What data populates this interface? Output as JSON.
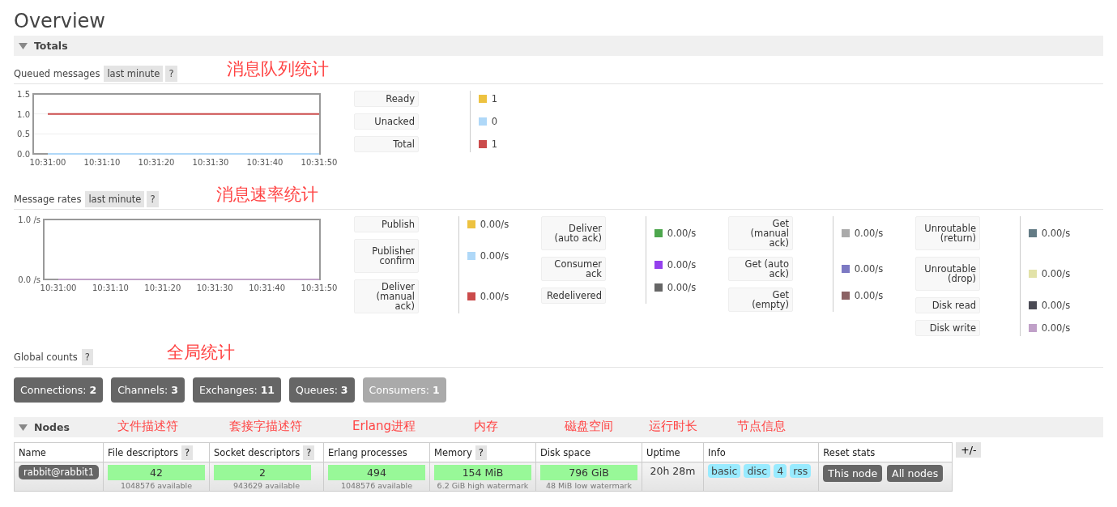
{
  "page_title": "Overview",
  "totals": {
    "title": "Totals",
    "expanded": true,
    "queued": {
      "label": "Queued messages",
      "range": "last minute",
      "help": "?",
      "annotation": "消息队列统计",
      "chart_data": {
        "type": "line",
        "categories": [
          "10:31:00",
          "10:31:10",
          "10:31:20",
          "10:31:30",
          "10:31:40",
          "10:31:50"
        ],
        "ylim": [
          0,
          1.5
        ],
        "yticks": [
          {
            "value": 0,
            "label": "0.0"
          },
          {
            "value": 0.5,
            "label": "0.5"
          },
          {
            "value": 1,
            "label": "1.0"
          },
          {
            "value": 1.5,
            "label": "1.5"
          }
        ],
        "series": [
          {
            "name": "Ready",
            "color": "#edc240",
            "values": [
              null,
              null,
              null,
              null,
              null,
              null
            ]
          },
          {
            "name": "Unacked",
            "color": "#afd8f8",
            "values": [
              0,
              0,
              0,
              0,
              0,
              0
            ]
          },
          {
            "name": "Total",
            "color": "#cb4b4b",
            "values": [
              1,
              1,
              1,
              1,
              1,
              1
            ]
          }
        ]
      },
      "readings": [
        "1",
        "0",
        "1"
      ]
    },
    "rates": {
      "label": "Message rates",
      "range": "last minute",
      "help": "?",
      "annotation": "消息速率统计",
      "chart_data": {
        "type": "line",
        "categories": [
          "10:31:00",
          "10:31:10",
          "10:31:20",
          "10:31:30",
          "10:31:40",
          "10:31:50"
        ],
        "ylim": [
          0,
          1
        ],
        "yticks": [
          {
            "value": 0,
            "label": "0.0 /s"
          },
          {
            "value": 1,
            "label": "1.0 /s"
          }
        ],
        "series": [
          {
            "name": "Publish",
            "color": "#edc240",
            "values": [
              null,
              null,
              null,
              null,
              null,
              null
            ]
          },
          {
            "name": "Publisher confirm",
            "color": "#afd8f8",
            "values": [
              null,
              null,
              null,
              null,
              null,
              null
            ]
          },
          {
            "name": "Deliver (manual ack)",
            "color": "#cb4b4b",
            "values": [
              null,
              null,
              null,
              null,
              null,
              null
            ]
          },
          {
            "name": "Deliver (auto ack)",
            "color": "#4da74d",
            "values": [
              null,
              null,
              null,
              null,
              null,
              null
            ]
          },
          {
            "name": "Consumer ack",
            "color": "#9440ed",
            "values": [
              null,
              null,
              null,
              null,
              null,
              null
            ]
          },
          {
            "name": "Redelivered",
            "color": "#666666",
            "values": [
              null,
              null,
              null,
              null,
              null,
              null
            ]
          },
          {
            "name": "Get (manual ack)",
            "color": "#aaaaaa",
            "values": [
              null,
              null,
              null,
              null,
              null,
              null
            ]
          },
          {
            "name": "Get (auto ack)",
            "color": "#7c79c3",
            "values": [
              null,
              null,
              null,
              null,
              null,
              null
            ]
          },
          {
            "name": "Get (empty)",
            "color": "#8b6264",
            "values": [
              null,
              null,
              null,
              null,
              null,
              null
            ]
          },
          {
            "name": "Unroutable (return)",
            "color": "#637b85",
            "values": [
              null,
              null,
              null,
              null,
              null,
              null
            ]
          },
          {
            "name": "Unroutable (drop)",
            "color": "#e2e2a8",
            "values": [
              null,
              null,
              null,
              null,
              null,
              null
            ]
          },
          {
            "name": "Disk read",
            "color": "#4b4b55",
            "values": [
              null,
              null,
              null,
              null,
              null,
              null
            ]
          },
          {
            "name": "Disk write",
            "color": "#c0a0c8",
            "values": [
              0,
              0,
              0,
              0,
              0,
              0
            ]
          }
        ]
      },
      "readings": [
        "0.00/s",
        "0.00/s",
        "0.00/s",
        "0.00/s",
        "0.00/s",
        "0.00/s",
        "0.00/s",
        "0.00/s",
        "0.00/s",
        "0.00/s",
        "0.00/s",
        "0.00/s",
        "0.00/s"
      ]
    },
    "global": {
      "label": "Global counts",
      "help": "?",
      "annotation": "全局统计",
      "counts": [
        {
          "label": "Connections:",
          "value": "2",
          "disabled": false
        },
        {
          "label": "Channels:",
          "value": "3",
          "disabled": false
        },
        {
          "label": "Exchanges:",
          "value": "11",
          "disabled": false
        },
        {
          "label": "Queues:",
          "value": "3",
          "disabled": false
        },
        {
          "label": "Consumers:",
          "value": "1",
          "disabled": true
        }
      ]
    }
  },
  "nodes": {
    "title": "Nodes",
    "expanded": true,
    "annotations": [
      "文件描述符",
      "套接字描述符",
      "Erlang进程",
      "内存",
      "磁盘空间",
      "运行时长",
      "节点信息"
    ],
    "columns": [
      {
        "label": "Name"
      },
      {
        "label": "File descriptors",
        "help": "?"
      },
      {
        "label": "Socket descriptors",
        "help": "?"
      },
      {
        "label": "Erlang processes"
      },
      {
        "label": "Memory",
        "help": "?"
      },
      {
        "label": "Disk space"
      },
      {
        "label": "Uptime"
      },
      {
        "label": "Info"
      },
      {
        "label": "Reset stats"
      }
    ],
    "toggle": "+/-",
    "rows": [
      {
        "cells": [
          {
            "kind": "name",
            "text": "rabbit@rabbit1"
          },
          {
            "kind": "meter",
            "value": "42",
            "note": "1048576 available"
          },
          {
            "kind": "meter",
            "value": "2",
            "note": "943629 available"
          },
          {
            "kind": "meter",
            "value": "494",
            "note": "1048576 available"
          },
          {
            "kind": "meter",
            "value": "154 MiB",
            "note": "6.2 GiB high watermark"
          },
          {
            "kind": "meter",
            "value": "796 GiB",
            "note": "48 MiB low watermark"
          },
          {
            "kind": "text",
            "text": "20h 28m"
          },
          {
            "kind": "tags",
            "items": [
              "basic",
              "disc",
              "4",
              "rss"
            ]
          },
          {
            "kind": "buttons",
            "items": [
              "This node",
              "All nodes"
            ]
          }
        ]
      }
    ]
  }
}
